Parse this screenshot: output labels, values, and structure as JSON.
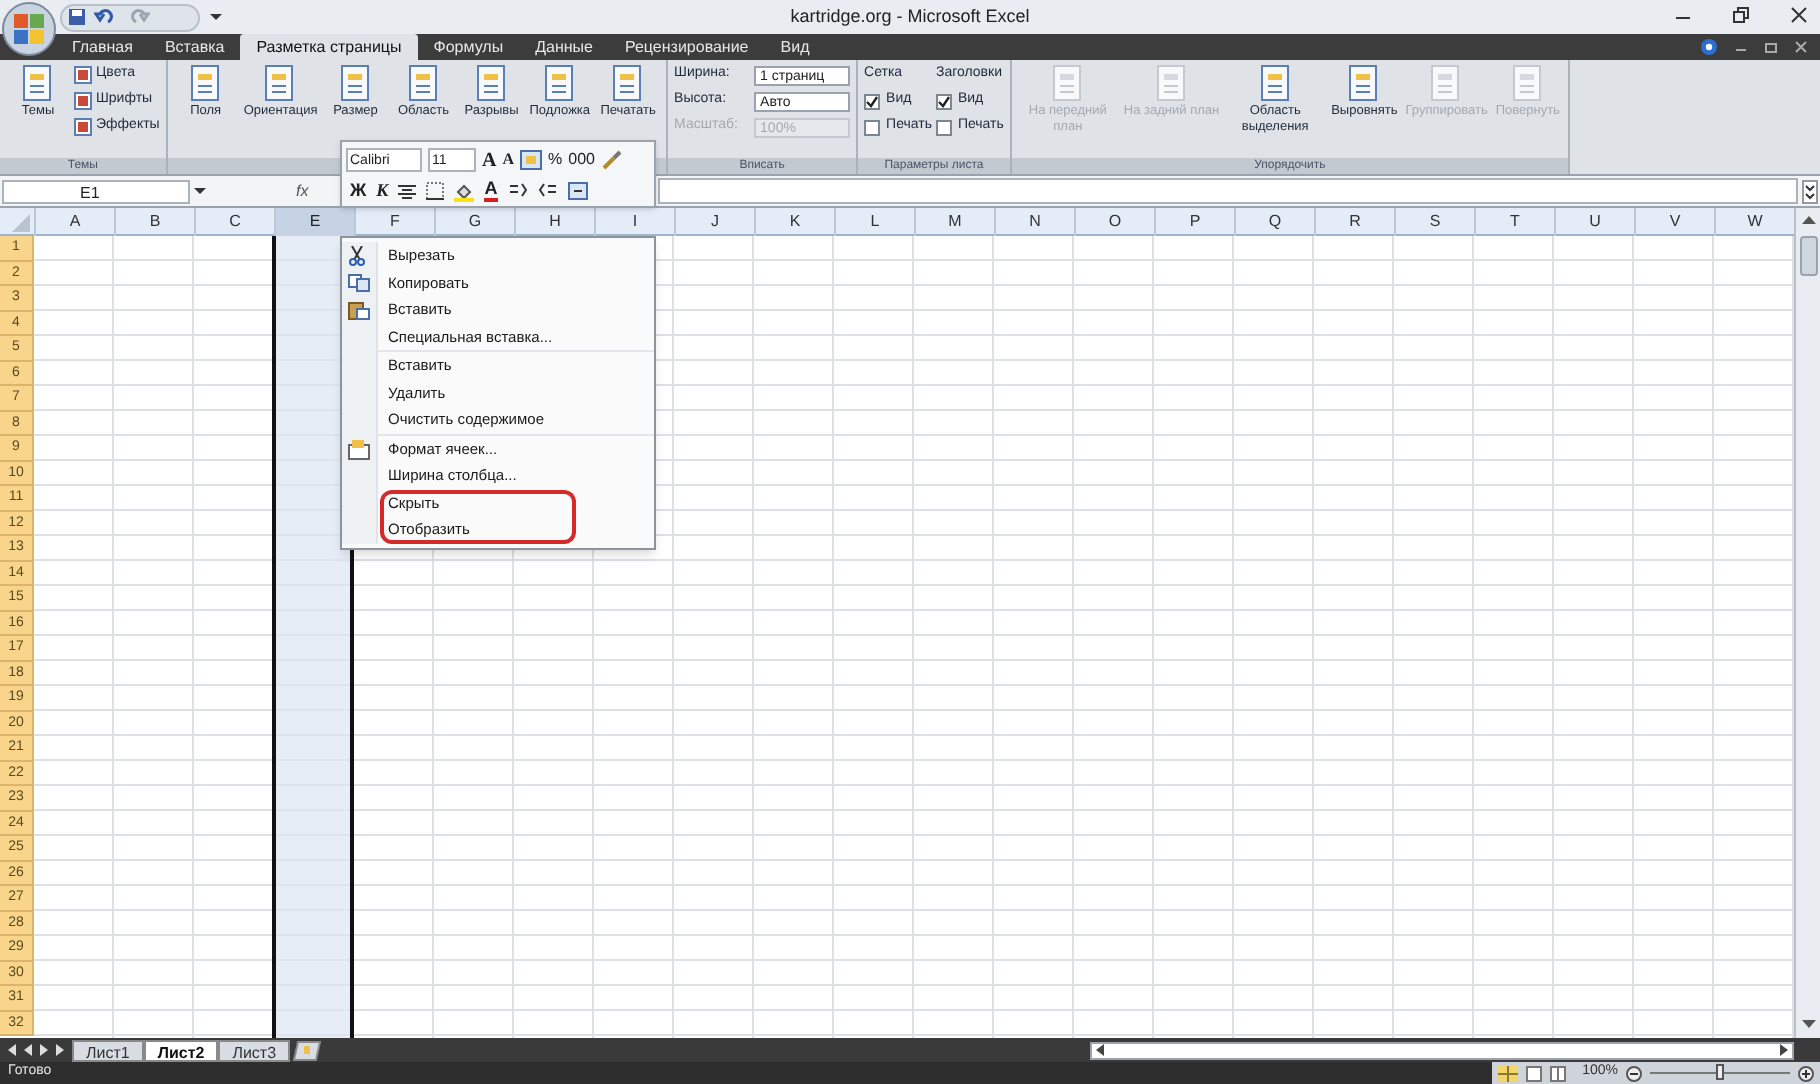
{
  "window": {
    "title": "kartridge.org - Microsoft Excel"
  },
  "tabs": [
    {
      "label": "Главная",
      "selected": false
    },
    {
      "label": "Вставка",
      "selected": false
    },
    {
      "label": "Разметка страницы",
      "selected": true
    },
    {
      "label": "Формулы",
      "selected": false
    },
    {
      "label": "Данные",
      "selected": false
    },
    {
      "label": "Рецензирование",
      "selected": false
    },
    {
      "label": "Вид",
      "selected": false
    }
  ],
  "ribbon": [
    {
      "label": "Темы",
      "columns": [
        [
          {
            "kind": "large",
            "label": "Темы"
          }
        ],
        [
          {
            "kind": "small",
            "label": "Цвета"
          },
          {
            "kind": "small",
            "label": "Шрифты"
          },
          {
            "kind": "small",
            "label": "Эффекты"
          }
        ]
      ]
    },
    {
      "columns": [
        [
          {
            "kind": "large",
            "label": "Поля"
          }
        ],
        [
          {
            "kind": "large",
            "label": "Ориентация"
          }
        ],
        [
          {
            "kind": "large",
            "label": "Размер"
          }
        ],
        [
          {
            "kind": "large",
            "label": "Область"
          }
        ],
        [
          {
            "kind": "large",
            "label": "Разрывы"
          }
        ],
        [
          {
            "kind": "large",
            "label": "Подложка"
          }
        ],
        [
          {
            "kind": "large",
            "label": "Печатать"
          }
        ]
      ]
    },
    {
      "label": "Вписать",
      "columns": [
        [
          {
            "kind": "spin",
            "label": "Ширина:",
            "value": "1 страниц",
            "disabled": false
          },
          {
            "kind": "spin",
            "label": "Высота:",
            "value": "Авто",
            "disabled": false
          },
          {
            "kind": "spin",
            "label": "Масштаб:",
            "value": "100%",
            "disabled": true
          }
        ]
      ]
    },
    {
      "label": "Параметры листа",
      "columns": [
        [
          {
            "kind": "heading",
            "label": "Сетка"
          },
          {
            "kind": "check",
            "label": "Вид",
            "checked": true
          },
          {
            "kind": "check",
            "label": "Печать",
            "checked": false
          }
        ],
        [
          {
            "kind": "heading",
            "label": "Заголовки"
          },
          {
            "kind": "check",
            "label": "Вид",
            "checked": true
          },
          {
            "kind": "check",
            "label": "Печать",
            "checked": false
          }
        ]
      ]
    },
    {
      "label": "Упорядочить",
      "columns": [
        [
          {
            "kind": "large",
            "label": "На передний план",
            "disabled": true
          }
        ],
        [
          {
            "kind": "large",
            "label": "На задний план",
            "disabled": true
          }
        ],
        [
          {
            "kind": "large",
            "label": "Область выделения",
            "disabled": false
          }
        ],
        [
          {
            "kind": "large",
            "label": "Выровнять",
            "disabled": false
          }
        ],
        [
          {
            "kind": "large",
            "label": "Группировать",
            "disabled": true
          }
        ],
        [
          {
            "kind": "large",
            "label": "Повернуть",
            "disabled": true
          }
        ]
      ]
    }
  ],
  "mini_toolbar": {
    "font": "Calibri",
    "size": "11",
    "row1": [
      "A",
      "A",
      "%",
      "000"
    ],
    "row2": [
      "Ж",
      "К",
      "A"
    ]
  },
  "formula_bar": {
    "name_box": "E1",
    "fx": "fx"
  },
  "columns": [
    {
      "label": "A",
      "selected": false
    },
    {
      "label": "B",
      "selected": false
    },
    {
      "label": "C",
      "selected": false
    },
    {
      "label": "E",
      "selected": true
    },
    {
      "label": "F",
      "selected": false
    },
    {
      "label": "G",
      "selected": false
    },
    {
      "label": "H",
      "selected": false
    },
    {
      "label": "I",
      "selected": false
    },
    {
      "label": "J",
      "selected": false
    },
    {
      "label": "K",
      "selected": false
    },
    {
      "label": "L",
      "selected": false
    },
    {
      "label": "M",
      "selected": false
    },
    {
      "label": "N",
      "selected": false
    },
    {
      "label": "O",
      "selected": false
    },
    {
      "label": "P",
      "selected": false
    },
    {
      "label": "Q",
      "selected": false
    },
    {
      "label": "R",
      "selected": false
    },
    {
      "label": "S",
      "selected": false
    },
    {
      "label": "T",
      "selected": false
    },
    {
      "label": "U",
      "selected": false
    },
    {
      "label": "V",
      "selected": false
    },
    {
      "label": "W",
      "selected": false
    }
  ],
  "rows": [
    "1",
    "2",
    "3",
    "4",
    "5",
    "6",
    "7",
    "8",
    "9",
    "10",
    "11",
    "12",
    "13",
    "14",
    "15",
    "16",
    "17",
    "18",
    "19",
    "20",
    "21",
    "22",
    "23",
    "24",
    "25",
    "26",
    "27",
    "28",
    "29",
    "30",
    "31",
    "32"
  ],
  "context_menu": [
    {
      "label": "Вырезать",
      "separator_after": false,
      "highlighted": false
    },
    {
      "label": "Копировать",
      "separator_after": false,
      "highlighted": false
    },
    {
      "label": "Вставить",
      "separator_after": false,
      "highlighted": false
    },
    {
      "label": "Специальная вставка...",
      "separator_after": true,
      "highlighted": false
    },
    {
      "label": "Вставить",
      "separator_after": false,
      "highlighted": false
    },
    {
      "label": "Удалить",
      "separator_after": false,
      "highlighted": false
    },
    {
      "label": "Очистить содержимое",
      "separator_after": true,
      "highlighted": false
    },
    {
      "label": "Формат ячеек...",
      "separator_after": false,
      "highlighted": false
    },
    {
      "label": "Ширина столбца...",
      "separator_after": false,
      "highlighted": false
    },
    {
      "label": "Скрыть",
      "separator_after": false,
      "highlighted": true
    },
    {
      "label": "Отобразить",
      "separator_after": false,
      "highlighted": true
    }
  ],
  "sheet_tabs": [
    {
      "label": "Лист1",
      "selected": false
    },
    {
      "label": "Лист2",
      "selected": true
    },
    {
      "label": "Лист3",
      "selected": false
    }
  ],
  "status_bar": {
    "text": "Готово",
    "zoom": "100%",
    "zoom_slider": {
      "level": 0.5
    }
  }
}
